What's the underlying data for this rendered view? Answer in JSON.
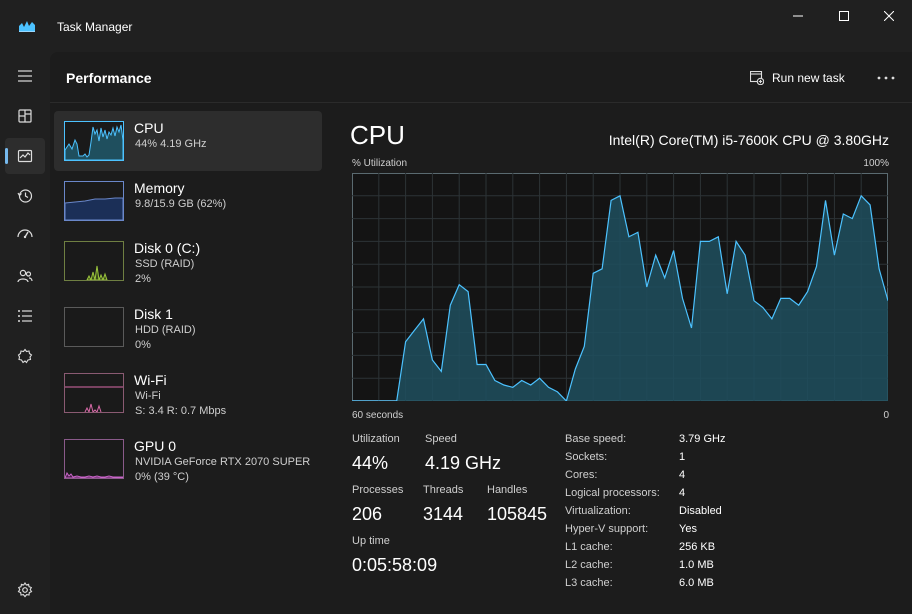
{
  "window": {
    "title": "Task Manager"
  },
  "nav": {
    "items": [
      {
        "name": "menu-icon"
      },
      {
        "name": "processes-icon"
      },
      {
        "name": "performance-icon"
      },
      {
        "name": "app-history-icon"
      },
      {
        "name": "startup-apps-icon"
      },
      {
        "name": "users-icon"
      },
      {
        "name": "details-icon"
      },
      {
        "name": "services-icon"
      },
      {
        "name": "settings-icon"
      }
    ],
    "active": "performance"
  },
  "header": {
    "title": "Performance",
    "run_new_task": "Run new task",
    "more_icon": "more-icon"
  },
  "devices": [
    {
      "name": "CPU",
      "lines": [
        "44% 4.19 GHz"
      ]
    },
    {
      "name": "Memory",
      "lines": [
        "9.8/15.9 GB (62%)"
      ]
    },
    {
      "name": "Disk 0 (C:)",
      "lines": [
        "SSD (RAID)",
        "2%"
      ]
    },
    {
      "name": "Disk 1",
      "lines": [
        "HDD (RAID)",
        "0%"
      ]
    },
    {
      "name": "Wi-Fi",
      "lines": [
        "Wi-Fi",
        "S: 3.4 R: 0.7 Mbps"
      ]
    },
    {
      "name": "GPU 0",
      "lines": [
        "NVIDIA GeForce RTX 2070 SUPER",
        "0% (39 °C)"
      ]
    }
  ],
  "detail": {
    "title": "CPU",
    "model": "Intel(R) Core(TM) i5-7600K CPU @ 3.80GHz",
    "graph": {
      "y_label": "% Utilization",
      "y_max_label": "100%",
      "x_left_label": "60 seconds",
      "x_right_label": "0",
      "color": "#4cc2ff",
      "fill": "#1f4f5e"
    },
    "stats": {
      "utilization_label": "Utilization",
      "utilization": "44%",
      "speed_label": "Speed",
      "speed": "4.19 GHz",
      "processes_label": "Processes",
      "processes": "206",
      "threads_label": "Threads",
      "threads": "3144",
      "handles_label": "Handles",
      "handles": "105845",
      "uptime_label": "Up time",
      "uptime": "0:05:58:09"
    },
    "specs": [
      {
        "label": "Base speed:",
        "value": "3.79 GHz"
      },
      {
        "label": "Sockets:",
        "value": "1"
      },
      {
        "label": "Cores:",
        "value": "4"
      },
      {
        "label": "Logical processors:",
        "value": "4"
      },
      {
        "label": "Virtualization:",
        "value": "Disabled"
      },
      {
        "label": "Hyper-V support:",
        "value": "Yes"
      },
      {
        "label": "L1 cache:",
        "value": "256 KB"
      },
      {
        "label": "L2 cache:",
        "value": "1.0 MB"
      },
      {
        "label": "L3 cache:",
        "value": "6.0 MB"
      }
    ]
  },
  "chart_data": {
    "type": "area",
    "x": [
      60,
      59,
      58,
      57,
      56,
      55,
      54,
      53,
      52,
      51,
      50,
      49,
      48,
      47,
      46,
      45,
      44,
      43,
      42,
      41,
      40,
      39,
      38,
      37,
      36,
      35,
      34,
      33,
      32,
      31,
      30,
      29,
      28,
      27,
      26,
      25,
      24,
      23,
      22,
      21,
      20,
      19,
      18,
      17,
      16,
      15,
      14,
      13,
      12,
      11,
      10,
      9,
      8,
      7,
      6,
      5,
      4,
      3,
      2,
      1,
      0
    ],
    "series": [
      {
        "values": [
          0,
          0,
          0,
          0,
          0,
          0,
          26,
          31,
          36,
          18,
          13,
          42,
          51,
          48,
          16,
          16,
          9,
          7,
          6,
          9,
          7,
          10,
          6,
          4,
          0,
          14,
          24,
          56,
          58,
          88,
          90,
          72,
          74,
          50,
          64,
          54,
          66,
          45,
          32,
          70,
          70,
          72,
          47,
          70,
          64,
          44,
          41,
          36,
          45,
          45,
          42,
          48,
          59,
          88,
          64,
          82,
          80,
          90,
          86,
          58,
          44
        ]
      }
    ],
    "ylim": [
      0,
      100
    ],
    "xlim": [
      60,
      0
    ],
    "grid": true
  }
}
